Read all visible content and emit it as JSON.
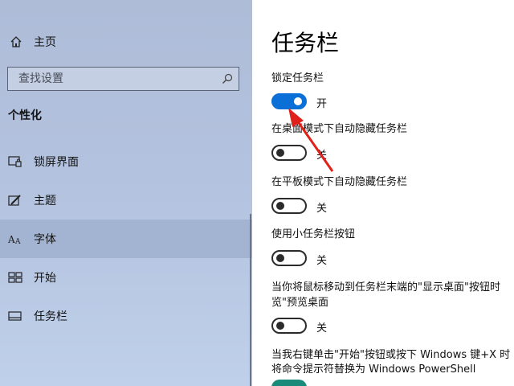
{
  "sidebar": {
    "home_label": "主页",
    "search_placeholder": "查找设置",
    "section_title": "个性化",
    "items": [
      {
        "label": "锁屏界面",
        "icon": "lock-screen-icon"
      },
      {
        "label": "主题",
        "icon": "theme-brush-icon"
      },
      {
        "label": "字体",
        "icon": "font-icon"
      },
      {
        "label": "开始",
        "icon": "start-tiles-icon"
      },
      {
        "label": "任务栏",
        "icon": "taskbar-icon"
      }
    ],
    "active_item": "字体"
  },
  "main": {
    "title": "任务栏",
    "settings": [
      {
        "label": "锁定任务栏",
        "state": "开",
        "on": true
      },
      {
        "label": "在桌面模式下自动隐藏任务栏",
        "state": "关",
        "on": false
      },
      {
        "label": "在平板模式下自动隐藏任务栏",
        "state": "关",
        "on": false
      },
      {
        "label": "使用小任务栏按钮",
        "state": "关",
        "on": false
      },
      {
        "label_line1": "当你将鼠标移动到任务栏末端的\"显示桌面\"按钮时",
        "label_line2": "览\"预览桌面",
        "state": "关",
        "on": false
      },
      {
        "label_line1": "当我右键单击\"开始\"按钮或按下 Windows 键+X 时",
        "label_line2": "将命令提示符替换为 Windows PowerShell"
      }
    ]
  },
  "colors": {
    "accent": "#0a6fd6",
    "sidebar_bg": "#b3c2de",
    "annotation_arrow": "#e0201a"
  }
}
